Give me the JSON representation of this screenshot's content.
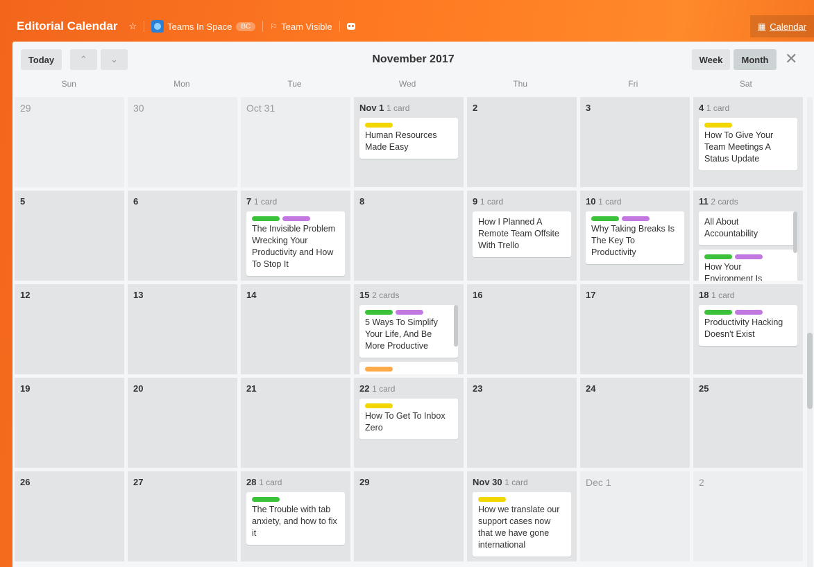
{
  "header": {
    "board_title": "Editorial Calendar",
    "team_name": "Teams In Space",
    "team_badge": "BC",
    "visibility": "Team Visible",
    "calendar_label": "Calendar"
  },
  "toolbar": {
    "today_label": "Today",
    "prev_icon": "chevron-up",
    "next_icon": "chevron-down",
    "month_title": "November 2017",
    "week_label": "Week",
    "month_label": "Month",
    "close_icon": "close"
  },
  "weekdays": [
    "Sun",
    "Mon",
    "Tue",
    "Wed",
    "Thu",
    "Fri",
    "Sat"
  ],
  "colors": {
    "yellow": "#f2d600",
    "green": "#3cc13b",
    "purple": "#c377e0",
    "orange": "#ffab4a",
    "header": "#f2661c"
  },
  "weeks": [
    [
      {
        "date": "29",
        "count": "",
        "other": true,
        "cards": []
      },
      {
        "date": "30",
        "count": "",
        "other": true,
        "cards": []
      },
      {
        "date": "Oct 31",
        "count": "",
        "other": true,
        "cards": []
      },
      {
        "date": "Nov 1",
        "count": "1 card",
        "other": false,
        "cards": [
          {
            "labels": [
              "yellow"
            ],
            "title": "Human Resources Made Easy"
          }
        ]
      },
      {
        "date": "2",
        "count": "",
        "other": false,
        "cards": []
      },
      {
        "date": "3",
        "count": "",
        "other": false,
        "cards": []
      },
      {
        "date": "4",
        "count": "1 card",
        "other": false,
        "cards": [
          {
            "labels": [
              "yellow"
            ],
            "title": "How To Give Your Team Meetings A Status Update"
          }
        ]
      }
    ],
    [
      {
        "date": "5",
        "count": "",
        "other": false,
        "cards": []
      },
      {
        "date": "6",
        "count": "",
        "other": false,
        "cards": []
      },
      {
        "date": "7",
        "count": "1 card",
        "other": false,
        "cards": [
          {
            "labels": [
              "green",
              "purple"
            ],
            "title": "The Invisible Problem Wrecking Your Productivity and How To Stop It"
          }
        ]
      },
      {
        "date": "8",
        "count": "",
        "other": false,
        "cards": []
      },
      {
        "date": "9",
        "count": "1 card",
        "other": false,
        "cards": [
          {
            "labels": [],
            "title": "How I Planned A Remote Team Offsite With Trello"
          }
        ]
      },
      {
        "date": "10",
        "count": "1 card",
        "other": false,
        "cards": [
          {
            "labels": [
              "green",
              "purple"
            ],
            "title": "Why Taking Breaks Is The Key To Productivity"
          }
        ]
      },
      {
        "date": "11",
        "count": "2 cards",
        "other": false,
        "scroll": true,
        "cards": [
          {
            "labels": [],
            "title": "All About Accountability"
          },
          {
            "labels": [
              "green",
              "purple"
            ],
            "title": "How Your Environment Is"
          }
        ]
      }
    ],
    [
      {
        "date": "12",
        "count": "",
        "other": false,
        "cards": []
      },
      {
        "date": "13",
        "count": "",
        "other": false,
        "cards": []
      },
      {
        "date": "14",
        "count": "",
        "other": false,
        "cards": []
      },
      {
        "date": "15",
        "count": "2 cards",
        "other": false,
        "scroll": true,
        "cards": [
          {
            "labels": [
              "green",
              "purple"
            ],
            "title": "5 Ways To Simplify Your Life, And Be More Productive"
          },
          {
            "labels": [
              "orange"
            ],
            "title": ""
          }
        ]
      },
      {
        "date": "16",
        "count": "",
        "other": false,
        "cards": []
      },
      {
        "date": "17",
        "count": "",
        "other": false,
        "cards": []
      },
      {
        "date": "18",
        "count": "1 card",
        "other": false,
        "cards": [
          {
            "labels": [
              "green",
              "purple"
            ],
            "title": "Productivity Hacking Doesn't Exist"
          }
        ]
      }
    ],
    [
      {
        "date": "19",
        "count": "",
        "other": false,
        "cards": []
      },
      {
        "date": "20",
        "count": "",
        "other": false,
        "cards": []
      },
      {
        "date": "21",
        "count": "",
        "other": false,
        "cards": []
      },
      {
        "date": "22",
        "count": "1 card",
        "other": false,
        "cards": [
          {
            "labels": [
              "yellow"
            ],
            "title": "How To Get To Inbox Zero"
          }
        ]
      },
      {
        "date": "23",
        "count": "",
        "other": false,
        "cards": []
      },
      {
        "date": "24",
        "count": "",
        "other": false,
        "cards": []
      },
      {
        "date": "25",
        "count": "",
        "other": false,
        "cards": []
      }
    ],
    [
      {
        "date": "26",
        "count": "",
        "other": false,
        "cards": []
      },
      {
        "date": "27",
        "count": "",
        "other": false,
        "cards": []
      },
      {
        "date": "28",
        "count": "1 card",
        "other": false,
        "cards": [
          {
            "labels": [
              "green"
            ],
            "title": "The Trouble with tab anxiety, and how to fix it"
          }
        ]
      },
      {
        "date": "29",
        "count": "",
        "other": false,
        "cards": []
      },
      {
        "date": "Nov 30",
        "count": "1 card",
        "other": false,
        "cards": [
          {
            "labels": [
              "yellow"
            ],
            "title": "How we translate our support cases now that we have gone international"
          }
        ]
      },
      {
        "date": "Dec 1",
        "count": "",
        "other": true,
        "cards": []
      },
      {
        "date": "2",
        "count": "",
        "other": true,
        "cards": []
      }
    ]
  ]
}
